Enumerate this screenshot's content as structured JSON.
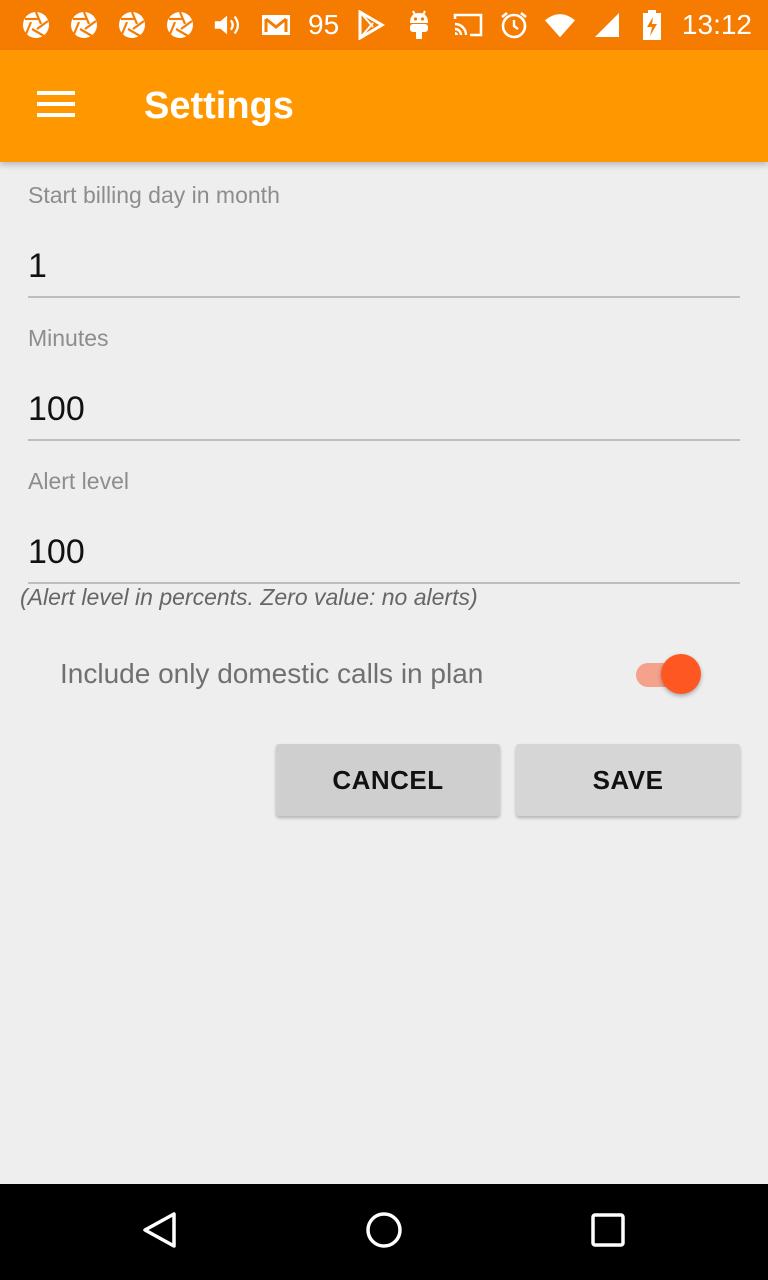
{
  "status_bar": {
    "notification_icons": [
      "aperture-icon",
      "aperture-icon",
      "aperture-icon",
      "aperture-icon",
      "volume-icon",
      "gmail-icon"
    ],
    "badge_number": "95",
    "more_icons": [
      "play-store-icon",
      "android-icon"
    ],
    "right_icons": [
      "cast-icon",
      "alarm-icon",
      "wifi-icon",
      "signal-icon",
      "battery-charging-icon"
    ],
    "time": "13:12",
    "background_color": "#f57c00"
  },
  "app_bar": {
    "title": "Settings",
    "menu_icon": "hamburger-menu-icon",
    "background_color": "#ff9800"
  },
  "form": {
    "billing_day": {
      "label": "Start billing day in month",
      "value": "1"
    },
    "minutes": {
      "label": "Minutes",
      "value": "100"
    },
    "alert_level": {
      "label": "Alert level",
      "value": "100"
    },
    "alert_hint": "(Alert level in percents. Zero value: no alerts)",
    "domestic_switch": {
      "label": "Include only domestic calls in plan",
      "checked": true,
      "accent_color": "#ff5722"
    }
  },
  "buttons": {
    "cancel": "CANCEL",
    "save": "SAVE"
  },
  "nav_bar": {
    "back_icon": "back-triangle-icon",
    "home_icon": "home-circle-icon",
    "recents_icon": "recents-square-icon"
  }
}
